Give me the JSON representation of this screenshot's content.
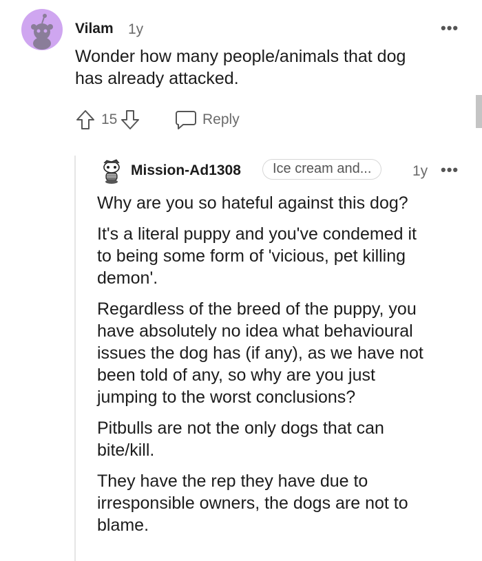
{
  "parent_comment": {
    "username": "Vilam",
    "age": "1y",
    "more_icon": "more-horizontal-icon",
    "text_lines": [
      "Wonder how many people/animals that dog",
      "has already attacked."
    ],
    "upvote_icon": "arrow-up-outline-icon",
    "vote_count": "15",
    "downvote_icon": "arrow-down-outline-icon",
    "reply_icon": "speech-bubble-icon",
    "reply_label": "Reply",
    "avatar_color": "#cfa6f0"
  },
  "reply_comment": {
    "username": "Mission-Ad1308",
    "flair": "Ice cream and...",
    "age": "1y",
    "more_icon": "more-horizontal-icon",
    "paragraphs": [
      [
        "Why are you so hateful against this dog?"
      ],
      [
        "It's a literal puppy and you've condemed it",
        "to being some form of 'vicious, pet killing",
        "demon'."
      ],
      [
        "Regardless of the breed of the puppy, you",
        "have absolutely no idea what behavioural",
        "issues the dog has (if any), as we have not",
        "been told of any, so why are you just",
        "jumping to the worst conclusions?"
      ],
      [
        "Pitbulls are not the only dogs that can",
        "bite/kill."
      ],
      [
        "They have the rep they have due to",
        "irresponsible owners, the dogs are not to",
        "blame."
      ]
    ]
  }
}
